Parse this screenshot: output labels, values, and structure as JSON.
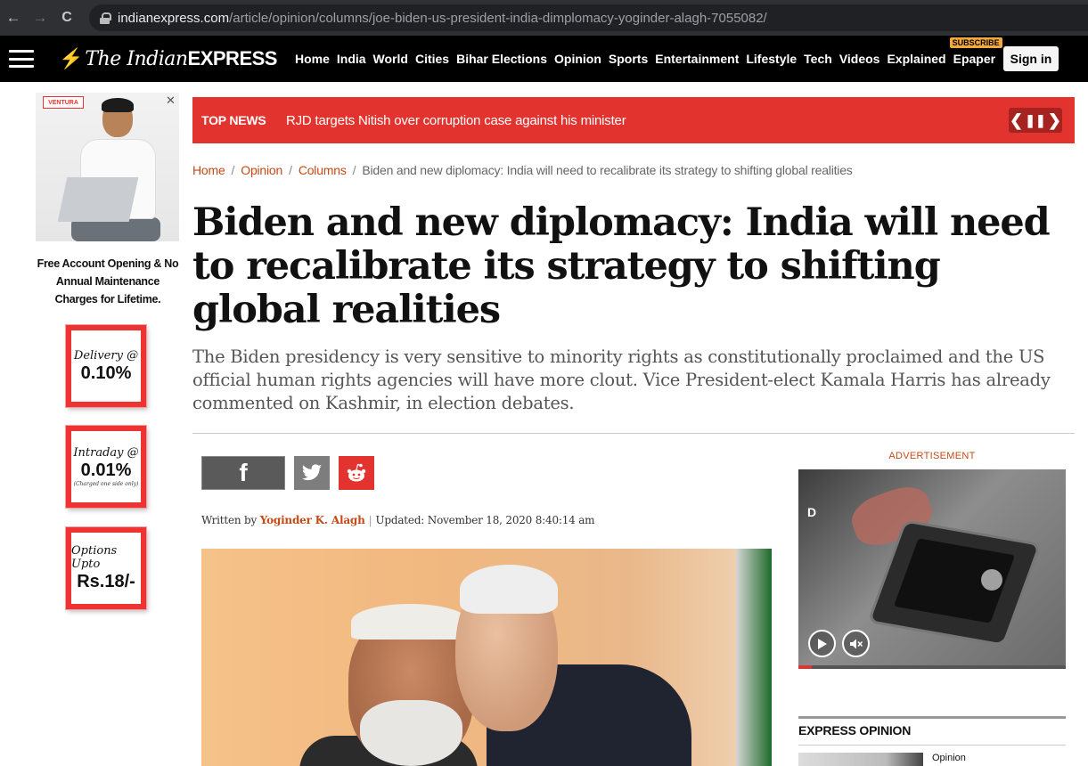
{
  "browser": {
    "back_icon": "←",
    "forward_icon": "→",
    "reload_icon": "C",
    "url_domain": "indianexpress.com",
    "url_path": "/article/opinion/columns/joe-biden-us-president-india-dimplomacy-yoginder-alagh-7055082/"
  },
  "header": {
    "logo_the": "The Indian",
    "logo_express": "EXPRESS",
    "nav": [
      "Home",
      "India",
      "World",
      "Cities",
      "Bihar Elections",
      "Opinion",
      "Sports",
      "Entertainment",
      "Lifestyle",
      "Tech",
      "Videos",
      "Explained",
      "Epaper"
    ],
    "subscribe_badge": "SUBSCRIBE",
    "signin": "Sign in",
    "colors": {
      "brand_red": "#e4322b",
      "accent_orange": "#f4a93b"
    }
  },
  "left_ad": {
    "close_icon": "✕",
    "brand": "VENTURA",
    "text": "Free Account Opening & No Annual Maintenance Charges for Lifetime.",
    "boxes": [
      {
        "line1": "Delivery @",
        "line2": "0.10%",
        "line3": ""
      },
      {
        "line1": "Intraday @",
        "line2": "0.01%",
        "line3": "(Charged one side only)"
      },
      {
        "line1": "Options Upto",
        "line2": "Rs.18/-",
        "line3": ""
      }
    ]
  },
  "top_news": {
    "label": "TOP NEWS",
    "headline": "RJD targets Nitish over corruption case against his minister",
    "prev": "❮",
    "pause": "❚❚",
    "next": "❯"
  },
  "breadcrumb": {
    "home": "Home",
    "opinion": "Opinion",
    "columns": "Columns",
    "current": "Biden and new diplomacy: India will need to recalibrate its strategy to shifting global realities",
    "sep": "/"
  },
  "article": {
    "headline": "Biden and new diplomacy: India will need to recalibrate its strategy to shifting global realities",
    "synopsis": "The Biden presidency is very sensitive to minority rights as constitutionally proclaimed and the US official human rights agencies will have more clout. Vice President-elect Kamala Harris has already commented on Kashmir, in election debates.",
    "written_by": "Written by",
    "author": "Yoginder K. Alagh",
    "byline_sep": "|",
    "updated": "Updated: November 18, 2020 8:40:14 am",
    "share": {
      "facebook": "f"
    }
  },
  "sidebar": {
    "advertisement_label": "ADVERTISEMENT",
    "video_progress": 0.05,
    "section_title": "EXPRESS OPINION",
    "opinion_label": "Opinion"
  }
}
